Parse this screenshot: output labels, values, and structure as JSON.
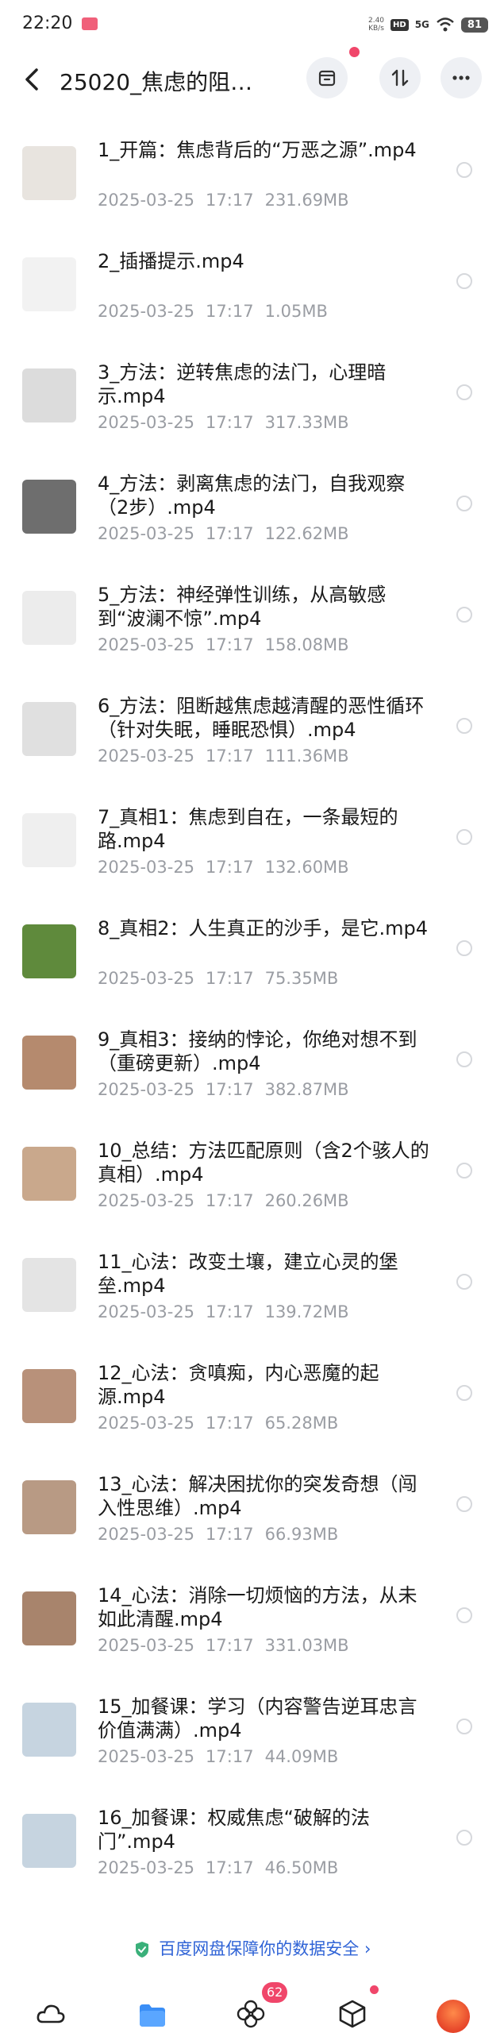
{
  "status_bar": {
    "time": "22:20",
    "net_speed_value": "2.40",
    "net_speed_unit": "KB/s",
    "hd": "HD",
    "network": "5G",
    "battery": "81"
  },
  "header": {
    "title": "25020_焦虑的阻…"
  },
  "files": [
    {
      "name": "1_开篇：焦虑背后的“万恶之源”.mp4",
      "date": "2025-03-25",
      "time": "17:17",
      "size": "231.69MB",
      "thumb": "#e8e4df"
    },
    {
      "name": "2_插播提示.mp4",
      "date": "2025-03-25",
      "time": "17:17",
      "size": "1.05MB",
      "thumb": "#f2f2f2"
    },
    {
      "name": "3_方法：逆转焦虑的法门，心理暗示.mp4",
      "date": "2025-03-25",
      "time": "17:17",
      "size": "317.33MB",
      "thumb": "#dcdcdc"
    },
    {
      "name": "4_方法：剥离焦虑的法门，自我观察（2步）.mp4",
      "date": "2025-03-25",
      "time": "17:17",
      "size": "122.62MB",
      "thumb": "#6e6e6e"
    },
    {
      "name": "5_方法：神经弹性训练，从高敏感到“波澜不惊”.mp4",
      "date": "2025-03-25",
      "time": "17:17",
      "size": "158.08MB",
      "thumb": "#ececec"
    },
    {
      "name": "6_方法：阻断越焦虑越清醒的恶性循环（针对失眠，睡眠恐惧）.mp4",
      "date": "2025-03-25",
      "time": "17:17",
      "size": "111.36MB",
      "thumb": "#e0e0e0"
    },
    {
      "name": "7_真相1：焦虑到自在，一条最短的路.mp4",
      "date": "2025-03-25",
      "time": "17:17",
      "size": "132.60MB",
      "thumb": "#efefef"
    },
    {
      "name": "8_真相2：人生真正的沙手，是它.mp4",
      "date": "2025-03-25",
      "time": "17:17",
      "size": "75.35MB",
      "thumb": "#5f8a3c"
    },
    {
      "name": "9_真相3：接纳的悖论，你绝对想不到（重磅更新）.mp4",
      "date": "2025-03-25",
      "time": "17:17",
      "size": "382.87MB",
      "thumb": "#b58a6e"
    },
    {
      "name": "10_总结：方法匹配原则（含2个骇人的真相）.mp4",
      "date": "2025-03-25",
      "time": "17:17",
      "size": "260.26MB",
      "thumb": "#c9a88c"
    },
    {
      "name": "11_心法：改变土壤，建立心灵的堡垒.mp4",
      "date": "2025-03-25",
      "time": "17:17",
      "size": "139.72MB",
      "thumb": "#e4e4e4"
    },
    {
      "name": "12_心法：贪嗔痴，内心恶魔的起源.mp4",
      "date": "2025-03-25",
      "time": "17:17",
      "size": "65.28MB",
      "thumb": "#b8917a"
    },
    {
      "name": "13_心法：解决困扰你的突发奇想（闯入性思维）.mp4",
      "date": "2025-03-25",
      "time": "17:17",
      "size": "66.93MB",
      "thumb": "#b89a84"
    },
    {
      "name": "14_心法：消除一切烦恼的方法，从未如此清醒.mp4",
      "date": "2025-03-25",
      "time": "17:17",
      "size": "331.03MB",
      "thumb": "#a8846c"
    },
    {
      "name": "15_加餐课：学习（内容警告逆耳忠言价值满满）.mp4",
      "date": "2025-03-25",
      "time": "17:17",
      "size": "44.09MB",
      "thumb": "#c6d4e0"
    },
    {
      "name": "16_加餐课：权威焦虑“破解的法门”.mp4",
      "date": "2025-03-25",
      "time": "17:17",
      "size": "46.50MB",
      "thumb": "#c6d4e0"
    }
  ],
  "footer": {
    "safety_text": "百度网盘保障你的数据安全",
    "safety_arrow": "›",
    "badge_count": "62"
  },
  "colors": {
    "accent_blue": "#2f63d6",
    "badge_red": "#f0466a",
    "meta_gray": "#9a9da3",
    "tab_blue": "#3a8ef6"
  }
}
